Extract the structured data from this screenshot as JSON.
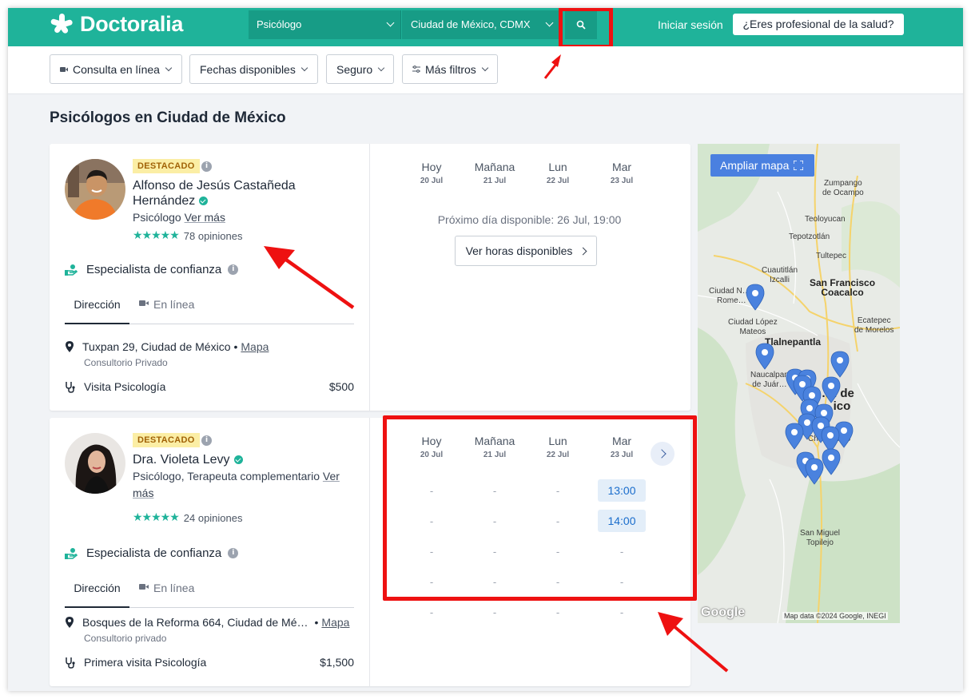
{
  "header": {
    "logo": "Doctoralia",
    "specialty": "Psicólogo",
    "location": "Ciudad de México, CDMX",
    "login": "Iniciar sesión",
    "pro_button": "¿Eres profesional de la salud?"
  },
  "filters": {
    "online": "Consulta en línea",
    "dates": "Fechas disponibles",
    "insurance": "Seguro",
    "more": "Más filtros"
  },
  "page_title": "Psicólogos en Ciudad de México",
  "calendar_days": [
    {
      "name": "Hoy",
      "date": "20 Jul"
    },
    {
      "name": "Mañana",
      "date": "21 Jul"
    },
    {
      "name": "Lun",
      "date": "22 Jul"
    },
    {
      "name": "Mar",
      "date": "23 Jul"
    }
  ],
  "doctors": [
    {
      "badge": "DESTACADO",
      "name": "Alfonso de Jesús Castañeda Hernández",
      "specialty": "Psicólogo",
      "more": "Ver más",
      "reviews": "78 opiniones",
      "trust": "Especialista de confianza",
      "tab_address": "Dirección",
      "tab_online": "En línea",
      "address": "Tuxpan 29, Ciudad de México",
      "map_link": "Mapa",
      "office": "Consultorio Privado",
      "visit": "Visita Psicología",
      "price": "$500",
      "next_available": "Próximo día disponible: 26 Jul, 19:00",
      "hours_button": "Ver horas disponibles"
    },
    {
      "badge": "DESTACADO",
      "name": "Dra. Violeta Levy",
      "specialty": "Psicólogo, Terapeuta complementario",
      "more": "Ver más",
      "reviews": "24 opiniones",
      "trust": "Especialista de confianza",
      "tab_address": "Dirección",
      "tab_online": "En línea",
      "address": "Bosques de la Reforma 664, Ciudad de Mé…",
      "map_link": "Mapa",
      "office": "Consultorio privado",
      "visit": "Primera visita Psicología",
      "price": "$1,500",
      "slots": [
        [
          "-",
          "-",
          "-",
          "13:00"
        ],
        [
          "-",
          "-",
          "-",
          "14:00"
        ],
        [
          "-",
          "-",
          "-",
          "-"
        ],
        [
          "-",
          "-",
          "-",
          "-"
        ],
        [
          "-",
          "-",
          "-",
          "-"
        ]
      ]
    }
  ],
  "map": {
    "expand": "Ampliar mapa",
    "google": "Google",
    "copyright": "Map data ©2024 Google, INEGI",
    "labels": {
      "zumpango": "Zumpango\nde Ocampo",
      "teoloyucan": "Teoloyucan",
      "tepotzotlan": "Tepotzotlán",
      "tultepec": "Tultepec",
      "cuautitlan": "Cuautitlán\nIzcalli",
      "san_francisco": "San Francisco\nCoacalco",
      "ciudad_nicolas": "Ciudad N…s\nRome…",
      "ciudad_lopez": "Ciudad López\nMateos",
      "ecatepec": "Ecatepec\nde Morelos",
      "tlalnepantla": "Tlalnepantla",
      "naucalpan": "Naucalpan\nde Juár…",
      "cdmx": "…d de\n…ico",
      "churubusco": "Churub…co",
      "san_miguel": "San Miguel\nTopilejo"
    }
  }
}
